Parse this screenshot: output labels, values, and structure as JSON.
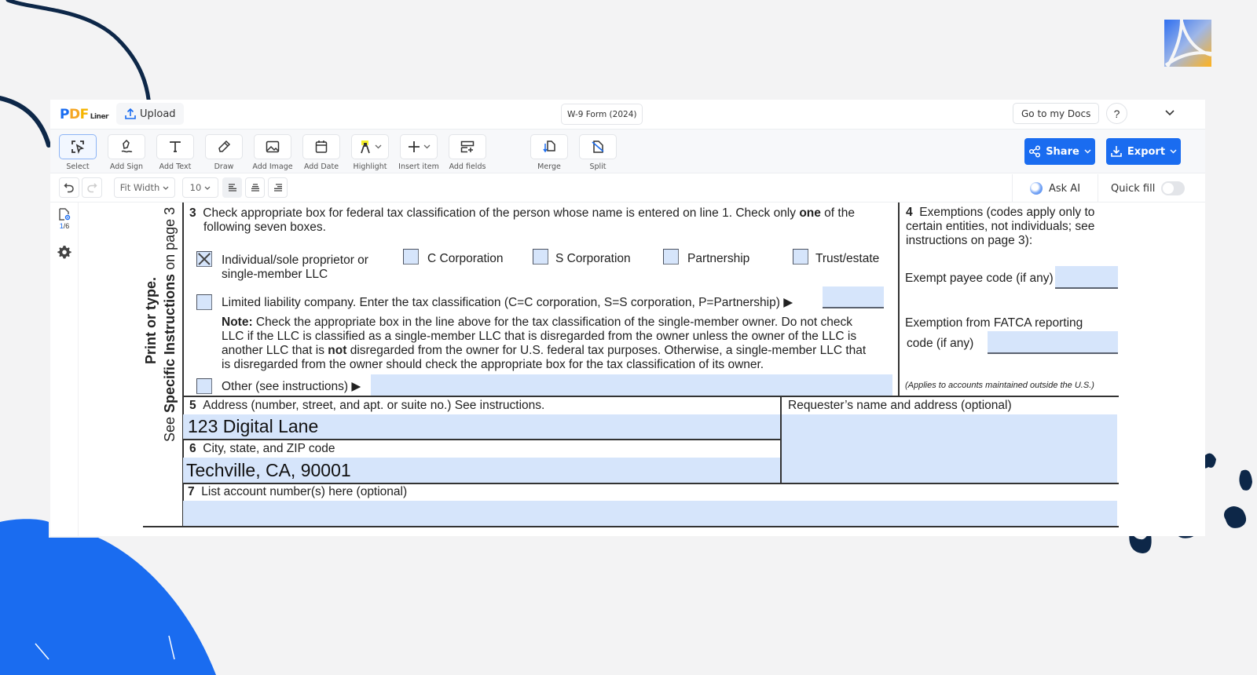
{
  "app": {
    "brand": {
      "p": "P",
      "d": "D",
      "f": "F",
      "liner": "Liner"
    },
    "upload_label": "Upload",
    "document_title": "W-9 Form (2024)",
    "goto_docs_label": "Go to my Docs",
    "help_label": "?",
    "accent_color": "#1a6cf0"
  },
  "toolbar": {
    "tools": [
      {
        "id": "select",
        "label": "Select",
        "icon": "select-icon",
        "active": true
      },
      {
        "id": "add-sign",
        "label": "Add Sign",
        "icon": "signature-icon"
      },
      {
        "id": "add-text",
        "label": "Add Text",
        "icon": "text-icon"
      },
      {
        "id": "draw",
        "label": "Draw",
        "icon": "pen-icon"
      },
      {
        "id": "add-image",
        "label": "Add Image",
        "icon": "image-icon"
      },
      {
        "id": "add-date",
        "label": "Add Date",
        "icon": "calendar-icon"
      },
      {
        "id": "highlight",
        "label": "Highlight",
        "icon": "highlight-icon"
      },
      {
        "id": "insert-item",
        "label": "Insert item",
        "icon": "plus-icon"
      },
      {
        "id": "add-fields",
        "label": "Add fields",
        "icon": "add-fields-icon"
      },
      {
        "id": "merge",
        "label": "Merge",
        "icon": "merge-icon"
      },
      {
        "id": "split",
        "label": "Split",
        "icon": "split-icon"
      }
    ],
    "share_label": "Share",
    "export_label": "Export"
  },
  "formatbar": {
    "zoom_value": "Fit Width",
    "font_size_value": "10",
    "ask_ai_label": "Ask AI",
    "quick_fill_label": "Quick fill",
    "quick_fill_enabled": false
  },
  "rail": {
    "page_current": "1",
    "page_total": "/6"
  },
  "form": {
    "side_label_1": "Print or type.",
    "side_label_2_pre": "See ",
    "side_label_2_bold": "Specific Instructions",
    "side_label_2_post": " on page 3",
    "line3": {
      "number": "3",
      "text_a": "Check appropriate box for federal tax classification of the person whose name is entered on line 1. Check only ",
      "text_bold": "one",
      "text_b": " of the",
      "text_c": "following seven boxes.",
      "options": [
        {
          "label_line1": "Individual/sole proprietor or",
          "label_line2": "single-member LLC",
          "checked": true
        },
        {
          "label_line1": "C Corporation",
          "checked": false
        },
        {
          "label_line1": "S Corporation",
          "checked": false
        },
        {
          "label_line1": "Partnership",
          "checked": false
        },
        {
          "label_line1": "Trust/estate",
          "checked": false
        }
      ],
      "llc_label": "Limited liability company. Enter the tax classification (C=C corporation, S=S corporation, P=Partnership) ▶",
      "llc_value": "",
      "note_bold": "Note:",
      "note_l1": " Check the appropriate box in the line above for the tax classification of the single-member owner.  Do not check",
      "note_l2": "LLC if the LLC is classified as a single-member LLC that is disregarded from the owner unless the owner of the LLC is",
      "note_l3a": "another LLC that is ",
      "note_l3bold": "not",
      "note_l3b": " disregarded from the owner for U.S. federal tax purposes. Otherwise, a single-member LLC that",
      "note_l4": "is disregarded from the owner should check the appropriate box for the tax classification of its owner.",
      "other_label": "Other (see instructions) ▶",
      "other_value": "",
      "other_checked": false
    },
    "line4": {
      "number": "4",
      "text_l1": "Exemptions (codes apply only to",
      "text_l2": "certain entities, not individuals; see",
      "text_l3": "instructions on page 3):",
      "exempt_payee_label": "Exempt payee code (if any)",
      "exempt_payee_value": "",
      "fatca_label_l1": "Exemption from FATCA reporting",
      "fatca_label_l2": "code (if any)",
      "fatca_value": "",
      "fatca_note": "(Applies to accounts maintained outside the U.S.)"
    },
    "line5": {
      "number": "5",
      "label": "Address (number, street, and apt. or suite no.) See instructions.",
      "value": "123 Digital Lane"
    },
    "line6": {
      "number": "6",
      "label": "City, state, and ZIP code",
      "value": "Techville, CA, 90001"
    },
    "requester": {
      "label": "Requester’s name and address (optional)",
      "value": ""
    },
    "line7": {
      "number": "7",
      "label": "List account number(s) here (optional)",
      "value": ""
    }
  }
}
